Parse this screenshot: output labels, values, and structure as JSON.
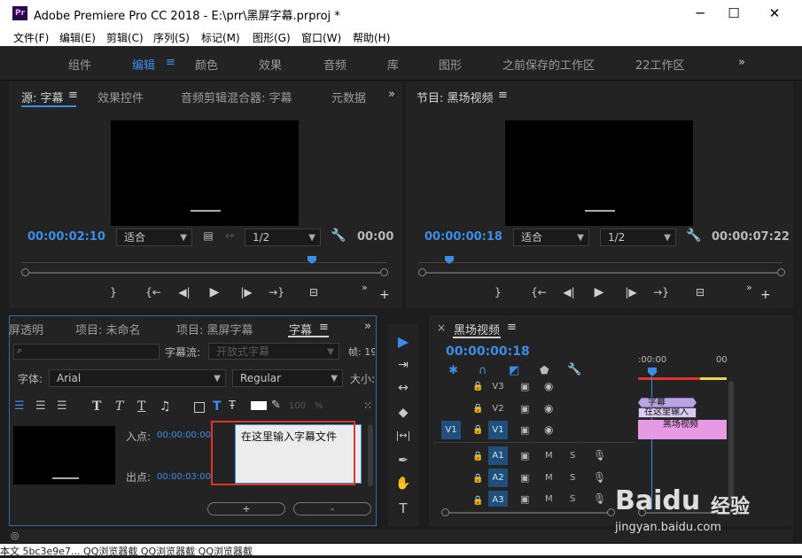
{
  "window": {
    "title": "Adobe Premiere Pro CC 2018 - E:\\prr\\黑屏字幕.prproj *",
    "logo": "Pr",
    "minimize": "─",
    "maximize": "☐",
    "close": "✕"
  },
  "menu": [
    "文件(F)",
    "编辑(E)",
    "剪辑(C)",
    "序列(S)",
    "标记(M)",
    "图形(G)",
    "窗口(W)",
    "帮助(H)"
  ],
  "workspaces": [
    "组件",
    "编辑",
    "颜色",
    "效果",
    "音频",
    "库",
    "图形",
    "之前保存的工作区",
    "22工作区"
  ],
  "workspace_menu": "≡",
  "workspace_more": "»",
  "source_tabs": [
    "源: 字幕",
    "效果控件",
    "音频剪辑混合器: 字幕",
    "元数据"
  ],
  "program_tab": "节目: 黑场视频",
  "panel_menu": "≡",
  "panel_more": "»",
  "source_monitor": {
    "timecode": "00:00:02:10",
    "fit": "适合",
    "resolution": "1/2",
    "duration": "00:00",
    "controls": [
      "}",
      "{←",
      "◀|",
      "▶",
      "|▶",
      "→}",
      "⊟"
    ],
    "add": "+"
  },
  "program_monitor": {
    "timecode": "00:00:00:18",
    "fit": "适合",
    "resolution": "1/2",
    "duration": "00:00:07:22",
    "controls": [
      "}",
      "{←",
      "◀|",
      "▶",
      "|▶",
      "→}",
      "⊟"
    ],
    "add": "+"
  },
  "project_tabs": [
    "屏透明",
    "项目: 未命名",
    "项目: 黑屏字幕",
    "字幕"
  ],
  "caption": {
    "stream_label": "字幕流:",
    "stream_value": "开放式字幕",
    "frame_label": "帧: 19",
    "font_label": "字体:",
    "font_value": "Arial",
    "style_value": "Regular",
    "size_label": "大小:",
    "opacity": "100",
    "opacity_unit": "%",
    "in_label": "入点:",
    "in_value": "00:00:00:00",
    "out_label": "出点:",
    "out_value": "00:00:03:00",
    "text_value": "在这里输入字幕文件",
    "add_button": "+",
    "remove_button": "-"
  },
  "timeline": {
    "close": "×",
    "title": "黑场视频",
    "timecode": "00:00:00:18",
    "ruler": [
      ":00:00",
      "00"
    ],
    "tracks": [
      {
        "name": "V3",
        "source": ""
      },
      {
        "name": "V2",
        "source": ""
      },
      {
        "name": "V1",
        "source": "V1"
      },
      {
        "name": "A1",
        "source": ""
      },
      {
        "name": "A2",
        "source": ""
      },
      {
        "name": "A3",
        "source": ""
      }
    ],
    "audio_m": "M",
    "audio_s": "S",
    "clips": {
      "title": "字幕",
      "title_text": "在这里输入",
      "black": "黑场视频"
    }
  },
  "tools": [
    "▶",
    "⇥",
    "↔",
    "◆",
    "|↔|",
    "✒",
    "✋",
    "T"
  ],
  "taskbar_text": "本文  5bc3e9e7...  QQ浏览器截  QQ浏览器截  QQ浏览器截",
  "watermark": {
    "brand": "Baidu",
    "sub": "经验",
    "url": "jingyan.baidu.com"
  },
  "colors": {
    "accent": "#3b8de8",
    "highlight": "#e0342e",
    "clip_title": "#b9a3e3",
    "clip_video": "#e59ae3"
  }
}
